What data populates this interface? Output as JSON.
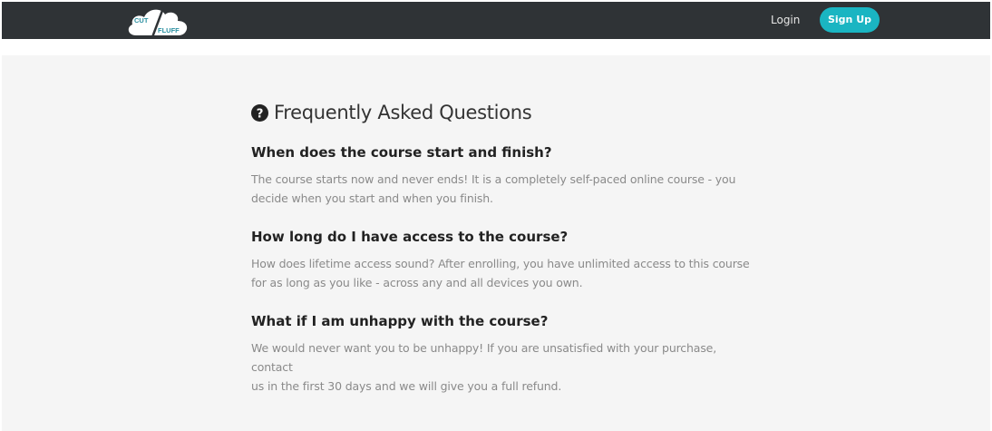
{
  "header": {
    "logo": {
      "icon": "cloud-logo-icon",
      "text_top": "CUT",
      "text_bottom": "FLUFF"
    },
    "login_label": "Login",
    "signup_label": "Sign Up"
  },
  "faq": {
    "icon": "question-circle-icon",
    "title": "Frequently Asked Questions",
    "items": [
      {
        "question": "When does the course start and finish?",
        "answer_lines": [
          "The course starts now and never ends! It is a completely self-paced online course - you",
          "decide when you start and when you finish."
        ]
      },
      {
        "question": "How long do I have access to the course?",
        "answer_lines": [
          "How does lifetime access sound? After enrolling, you have unlimited access to this course",
          "for as long as you like - across any and all devices you own."
        ]
      },
      {
        "question": "What if I am unhappy with the course?",
        "answer_lines": [
          "We would never want you to be unhappy! If you are unsatisfied with your purchase, contact",
          "us in the first 30 days and we will give you a full refund."
        ]
      }
    ]
  },
  "colors": {
    "navbar": "#2f3336",
    "accent": "#1ab5c2",
    "panel": "#f5f5f5"
  }
}
